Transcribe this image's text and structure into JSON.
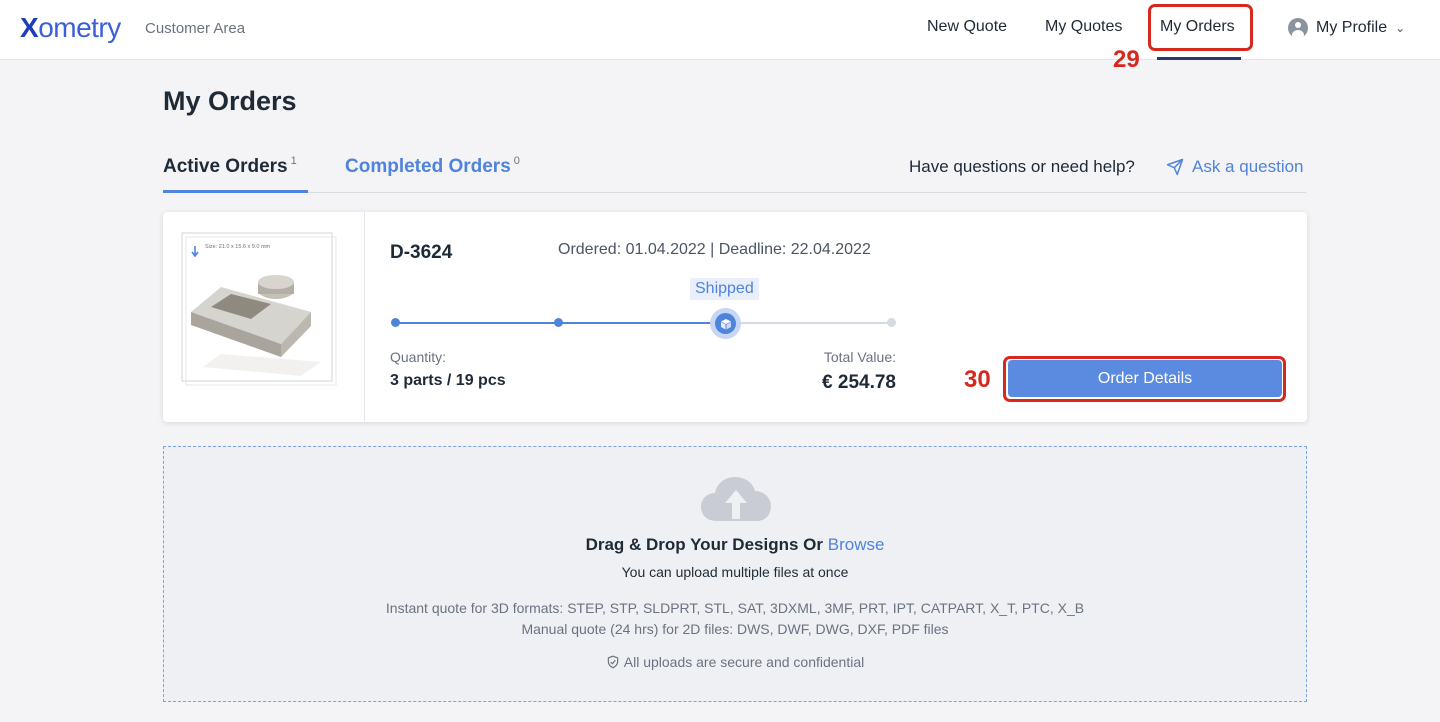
{
  "header": {
    "logo": "ometry",
    "logo_x": "X",
    "area": "Customer Area",
    "nav": {
      "new_quote": "New Quote",
      "my_quotes": "My Quotes",
      "my_orders": "My Orders"
    },
    "profile": "My Profile"
  },
  "annotations": {
    "n29": "29",
    "n30": "30"
  },
  "page": {
    "title": "My Orders",
    "tabs": {
      "active": "Active Orders",
      "active_count": "1",
      "completed": "Completed Orders",
      "completed_count": "0"
    },
    "help_text": "Have questions or need help?",
    "ask_link": "Ask a question"
  },
  "order": {
    "id": "D-3624",
    "dates": "Ordered: 01.04.2022  |  Deadline: 22.04.2022",
    "status": "Shipped",
    "thumb_caption": "Size: 21.0 x 15.6 x 9.0 mm",
    "progress_steps": 4,
    "progress_current_step": 3,
    "quantity_label": "Quantity:",
    "quantity_value": "3 parts / 19 pcs",
    "total_label": "Total Value:",
    "total_value": "€ 254.78",
    "details_button": "Order Details"
  },
  "upload": {
    "drag_text": "Drag & Drop Your Designs Or",
    "browse": "Browse",
    "multi": "You can upload multiple files at once",
    "formats_3d": "Instant quote for 3D formats: STEP, STP, SLDPRT, STL, SAT, 3DXML, 3MF, PRT, IPT, CATPART, X_T, PTC, X_B",
    "formats_2d": "Manual quote (24 hrs) for 2D files: DWS, DWF, DWG, DXF, PDF files",
    "secure": "All uploads are secure and confidential"
  },
  "colors": {
    "accent": "#4f83dc",
    "highlight": "#d7281e",
    "navy": "#273a6d"
  }
}
